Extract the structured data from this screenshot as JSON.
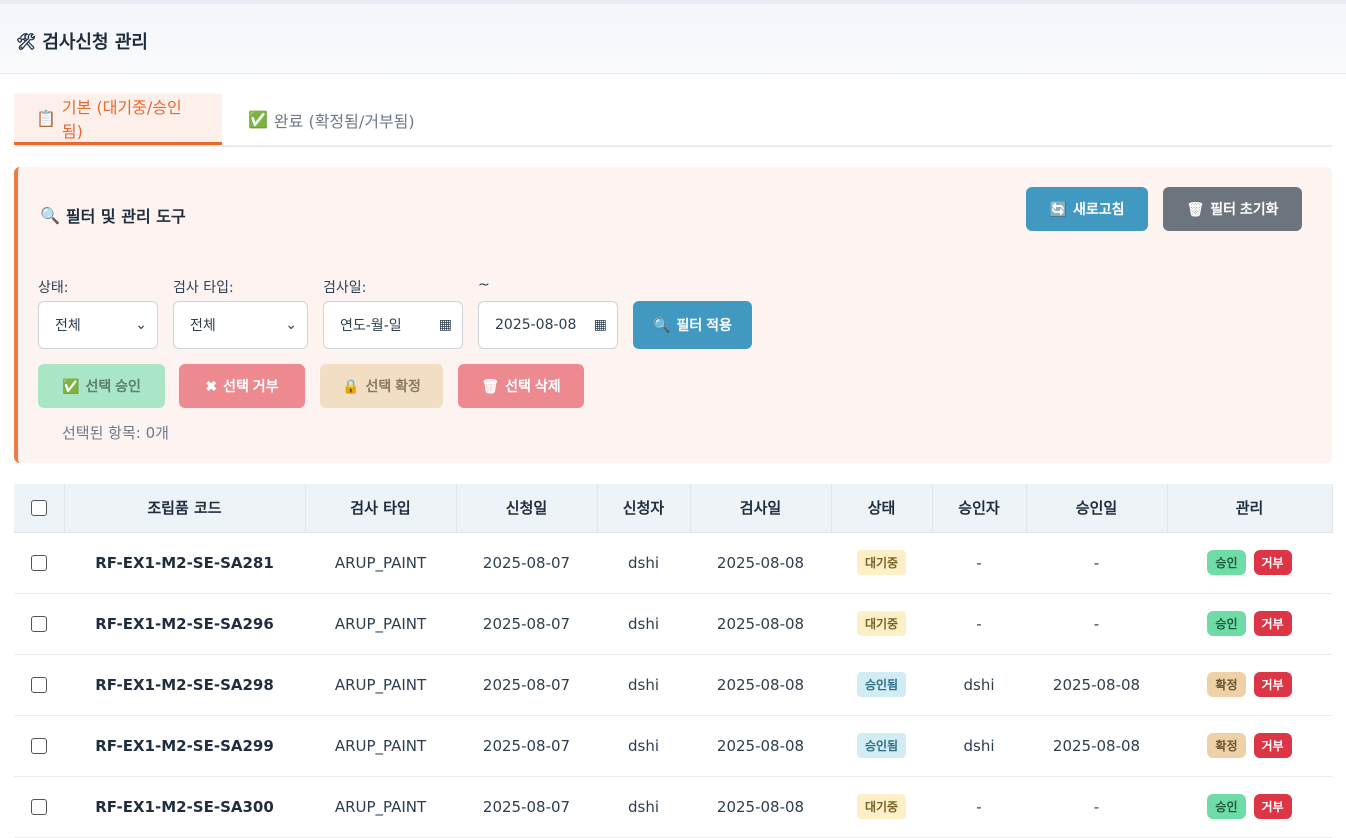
{
  "header": {
    "title": "검사신청 관리",
    "icon": "🛠"
  },
  "tabs": [
    {
      "label": "기본 (대기중/승인됨)",
      "icon": "📋",
      "active": true
    },
    {
      "label": "완료 (확정됨/거부됨)",
      "icon": "✅",
      "active": false
    }
  ],
  "filter": {
    "title": "필터 및 관리 도구",
    "refresh_label": "새로고침",
    "reset_label": "필터 초기화",
    "status_label": "상태:",
    "status_value": "전체",
    "type_label": "검사 타입:",
    "type_value": "전체",
    "date_label": "검사일:",
    "date_from_value": "연도-월-일",
    "tilde_label": "~",
    "date_to_value": "2025-08-08",
    "apply_label": "필터 적용",
    "bulk_approve": "선택 승인",
    "bulk_reject": "선택 거부",
    "bulk_confirm": "선택 확정",
    "bulk_delete": "선택 삭제",
    "selected_count": "선택된 항목: 0개"
  },
  "table": {
    "headers": [
      "조립품 코드",
      "검사 타입",
      "신청일",
      "신청자",
      "검사일",
      "상태",
      "승인자",
      "승인일",
      "관리"
    ],
    "rows": [
      {
        "code": "RF-EX1-M2-SE-SA281",
        "type": "ARUP_PAINT",
        "request_date": "2025-08-07",
        "requester": "dshi",
        "inspect_date": "2025-08-08",
        "status": "대기중",
        "approver": "-",
        "approve_date": "-",
        "actions": [
          "승인",
          "거부"
        ]
      },
      {
        "code": "RF-EX1-M2-SE-SA296",
        "type": "ARUP_PAINT",
        "request_date": "2025-08-07",
        "requester": "dshi",
        "inspect_date": "2025-08-08",
        "status": "대기중",
        "approver": "-",
        "approve_date": "-",
        "actions": [
          "승인",
          "거부"
        ]
      },
      {
        "code": "RF-EX1-M2-SE-SA298",
        "type": "ARUP_PAINT",
        "request_date": "2025-08-07",
        "requester": "dshi",
        "inspect_date": "2025-08-08",
        "status": "승인됨",
        "approver": "dshi",
        "approve_date": "2025-08-08",
        "actions": [
          "확정",
          "거부"
        ]
      },
      {
        "code": "RF-EX1-M2-SE-SA299",
        "type": "ARUP_PAINT",
        "request_date": "2025-08-07",
        "requester": "dshi",
        "inspect_date": "2025-08-08",
        "status": "승인됨",
        "approver": "dshi",
        "approve_date": "2025-08-08",
        "actions": [
          "확정",
          "거부"
        ]
      },
      {
        "code": "RF-EX1-M2-SE-SA300",
        "type": "ARUP_PAINT",
        "request_date": "2025-08-07",
        "requester": "dshi",
        "inspect_date": "2025-08-08",
        "status": "대기중",
        "approver": "-",
        "approve_date": "-",
        "actions": [
          "승인",
          "거부"
        ]
      }
    ]
  },
  "colors": {
    "accent": "#e8692f",
    "primary": "#4199c1",
    "danger": "#dc3545",
    "success": "#6fdca8"
  }
}
